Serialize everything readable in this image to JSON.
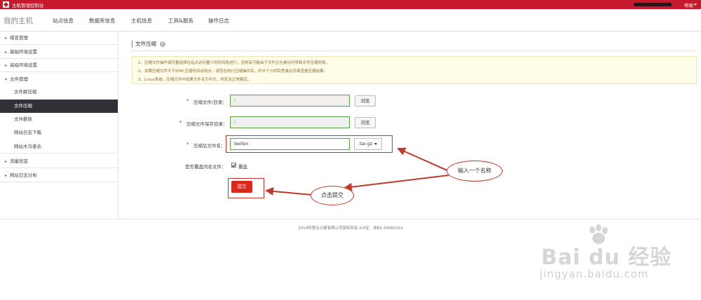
{
  "topbar": {
    "app_title": "主机管理控制台",
    "help": "帮助"
  },
  "navbar": {
    "brand": "我的主机",
    "items": [
      "站点信息",
      "数据库信息",
      "主机信息",
      "工具&服务",
      "操作日志"
    ]
  },
  "sidebar": {
    "groups": [
      {
        "label": "域名管理",
        "caret": "▸"
      },
      {
        "label": "基础环境设置",
        "caret": "▸"
      },
      {
        "label": "高级环境设置",
        "caret": "▸"
      },
      {
        "label": "文件管理",
        "caret": "▾"
      }
    ],
    "file_subitems": [
      "文件解压缩",
      "文件压缩",
      "文件删除",
      "网站日志下载",
      "网站木马查杀"
    ],
    "active_subitem": "文件压缩",
    "groups_after": [
      {
        "label": "流量状态",
        "caret": "▸"
      },
      {
        "label": "网站日志分析",
        "caret": "▸"
      }
    ]
  },
  "main": {
    "section_title": "文件压缩",
    "help_icon": "question-icon",
    "notice_lines": [
      "1、压缩文件操作请尽量选择在站点访问量少的时间段进行，否则有可能由于文件正在被访问导致文件压缩失败。",
      "2、如果压缩文件大于80M,压缩时间会较长，请您在执行压缩操作后，约半个小时后登录此页面查看压缩结果。",
      "3、Linux系统，压缩文件中如果文件名为中文，则无法正常解压。"
    ],
    "form": {
      "required_mark": "*",
      "source_label": "压缩文件/目录：",
      "source_value": "/",
      "save_label": "压缩文件保存目录：",
      "save_value": "/",
      "browse_label": "浏览",
      "name_label": "压缩后文件名：",
      "name_value": "beifen",
      "format_value": ".tar.gz",
      "overwrite_label": "是否覆盖同名文件：",
      "overwrite_checked_label": "覆盖",
      "submit_label": "提交"
    },
    "annotations": {
      "name_callout": "输入一个名称",
      "submit_callout": "点击提交"
    }
  },
  "footer": {
    "text": "2014阿里云计算有限公司版权所有 ICP证：浙B2-20080101"
  },
  "watermark": {
    "brand": "Bai du 经验",
    "url": "jingyan.baidu.com"
  },
  "colors": {
    "brand_red": "#c6192b",
    "active_side_bg": "#2f3136",
    "input_border": "#58a145",
    "submit_red": "#d9291f",
    "annotation_red": "#c0392b"
  }
}
